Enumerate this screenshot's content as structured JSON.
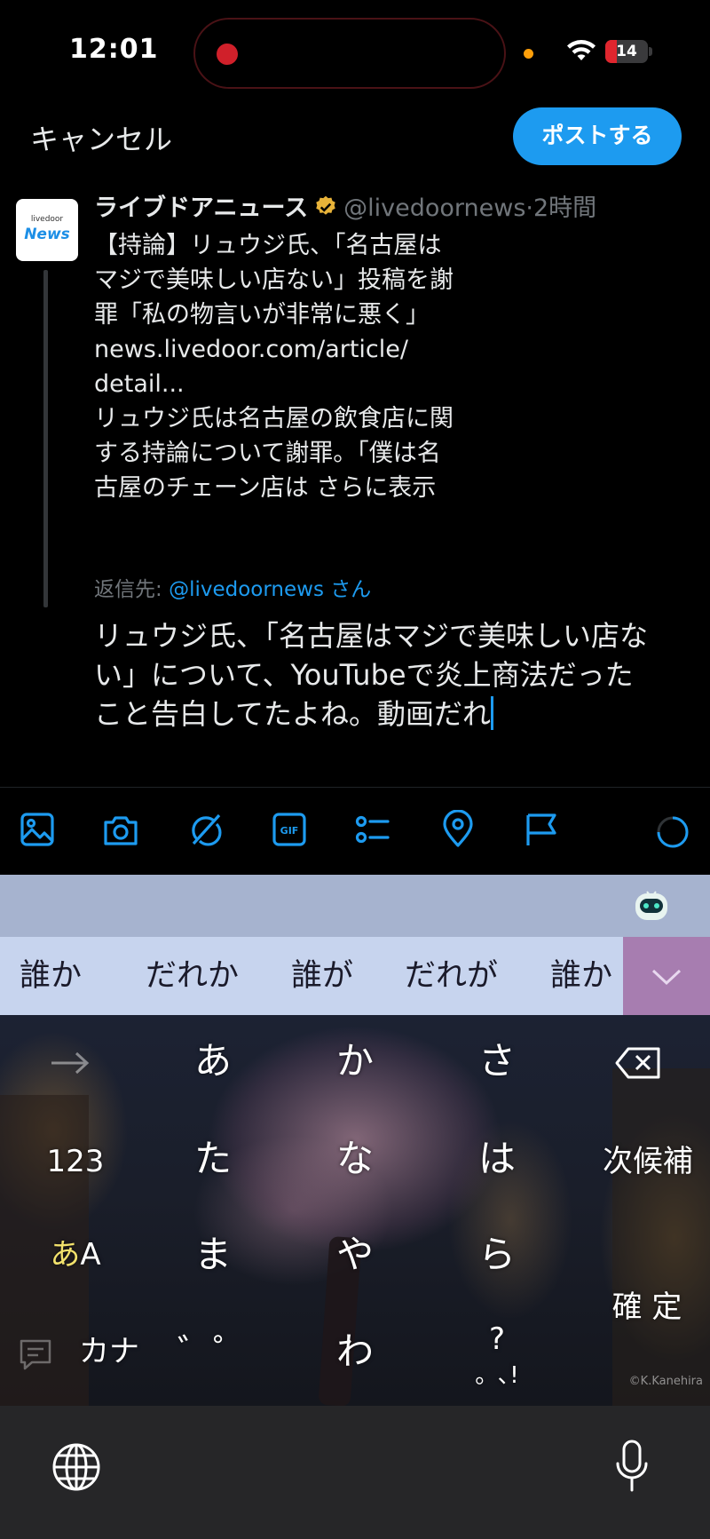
{
  "status_bar": {
    "time": "12:01",
    "battery": {
      "level_text": "14",
      "level_fraction": 0.14
    }
  },
  "compose": {
    "cancel_label": "キャンセル",
    "post_label": "ポストする",
    "reply_to_prefix": "返信先:",
    "reply_to_handle": "@livedoornews さん",
    "text_lines": [
      "リュウジ氏、「名古屋はマジで美味しい店な",
      "い」について、YouTubeで炎上商法だった",
      "こと告白してたよね。動画だれ"
    ]
  },
  "quoted_tweet": {
    "avatar_top": "livedoor",
    "avatar_main": "News",
    "author_name": "ライブドアニュース",
    "handle": "@livedoornews",
    "separator": "·",
    "time": "2時間",
    "body_lines": [
      "【持論】リュウジ氏、「名古屋は",
      "マジで美味しい店ない」投稿を謝",
      "罪「私の物言いが非常に悪く」",
      "news.livedoor.com/article/",
      "detail...",
      "リュウジ氏は名古屋の飲食店に関",
      "する持論について謝罪。「僕は名",
      "古屋のチェーン店は "
    ],
    "show_more": "さらに表示"
  },
  "toolbar": {
    "icons": [
      "image-icon",
      "camera-icon",
      "grok-icon",
      "gif-icon",
      "poll-icon",
      "location-icon",
      "flag-icon"
    ],
    "gif_label": "GIF"
  },
  "keyboard": {
    "candidates": [
      "誰か",
      "だれか",
      "誰が",
      "だれが",
      "誰か"
    ],
    "keys": {
      "row1": [
        "あ",
        "か",
        "さ"
      ],
      "row2": [
        "た",
        "な",
        "は"
      ],
      "row3": [
        "ま",
        "や",
        "ら"
      ],
      "row4": [
        "わ"
      ],
      "numbers": "123",
      "next_candidate": "次候補",
      "mode_kana": "あ",
      "mode_alpha": "A",
      "confirm": "確 定",
      "katakana": "カナ",
      "dakuten": "゛゜",
      "punct_top": "?",
      "punct_bottom": "。､!"
    },
    "credit": "©K.Kanehira"
  },
  "colors": {
    "accent": "#1d9bf0",
    "candidate_bar": "#c7d4ee",
    "candidate_expand": "#a77db0"
  }
}
